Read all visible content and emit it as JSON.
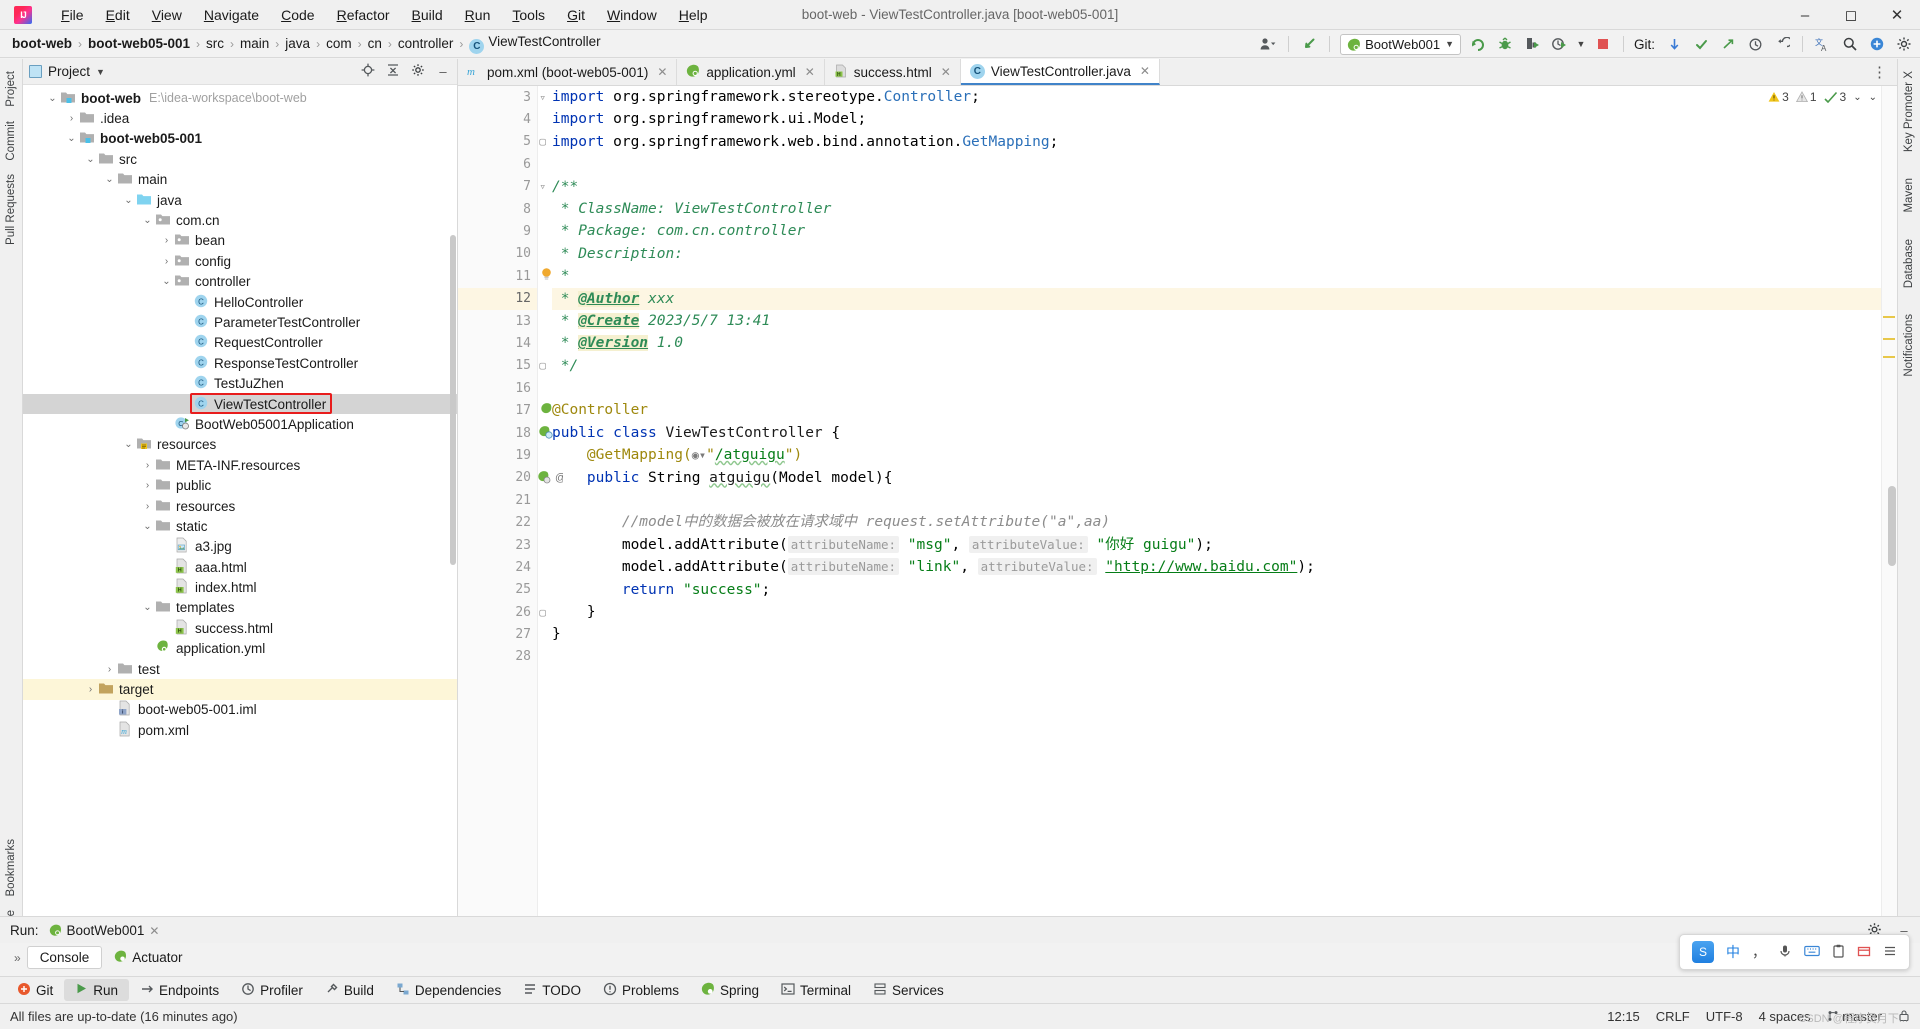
{
  "titlebar": {
    "logo": "intellij-logo",
    "window_title": "boot-web - ViewTestController.java [boot-web05-001]",
    "menus": [
      {
        "label": "File",
        "mnemonic": "F"
      },
      {
        "label": "Edit",
        "mnemonic": "E"
      },
      {
        "label": "View",
        "mnemonic": "V"
      },
      {
        "label": "Navigate",
        "mnemonic": "N"
      },
      {
        "label": "Code",
        "mnemonic": "C"
      },
      {
        "label": "Refactor",
        "mnemonic": "R"
      },
      {
        "label": "Build",
        "mnemonic": "B"
      },
      {
        "label": "Run",
        "mnemonic": "R"
      },
      {
        "label": "Tools",
        "mnemonic": "T"
      },
      {
        "label": "Git",
        "mnemonic": "G"
      },
      {
        "label": "Window",
        "mnemonic": "W"
      },
      {
        "label": "Help",
        "mnemonic": "H"
      }
    ],
    "minimize": "–",
    "maximize": "❐",
    "close": "✕"
  },
  "navbar": {
    "breadcrumbs": [
      {
        "label": "boot-web",
        "bold": true
      },
      {
        "label": "boot-web05-001",
        "bold": true
      },
      {
        "label": "src",
        "bold": false
      },
      {
        "label": "main",
        "bold": false
      },
      {
        "label": "java",
        "bold": false
      },
      {
        "label": "com",
        "bold": false
      },
      {
        "label": "cn",
        "bold": false
      },
      {
        "label": "controller",
        "bold": false
      },
      {
        "label": "ViewTestController",
        "bold": false,
        "icon": "C"
      }
    ],
    "separator": "›",
    "run_config": "BootWeb001",
    "run_config_dropdown": "▼",
    "git_label": "Git:",
    "icons": {
      "account": "account-icon",
      "search_everywhere": "search-icon",
      "run": "run-icon",
      "debug": "debug-icon",
      "coverage": "coverage-icon",
      "profiler": "profiler-icon",
      "stop": "stop-icon",
      "update_project": "update-project-icon",
      "commit": "commit-icon",
      "push": "push-icon",
      "history": "history-icon",
      "rollback": "rollback-icon",
      "translate": "translate-icon",
      "search": "magnifier-icon",
      "plugin": "plugin-icon",
      "settings": "gear-icon"
    }
  },
  "left_strip": {
    "top": [
      "Project",
      "Commit",
      "Pull Requests"
    ],
    "bottom": [
      "Bookmarks",
      "Structure"
    ]
  },
  "right_strip": [
    "Key Promoter X",
    "Maven",
    "Database",
    "Notifications"
  ],
  "project_panel": {
    "title": "Project",
    "dropdown": "▼",
    "locate_icon": "crosshair-icon",
    "collapse_icon": "collapse-all-icon",
    "settings_icon": "gear-icon",
    "hide_icon": "minimize-icon",
    "tree": [
      {
        "indent": 0,
        "arrow": "⌄",
        "icon": "module-folder",
        "label": "boot-web",
        "bold": true,
        "path": "E:\\idea-workspace\\boot-web"
      },
      {
        "indent": 1,
        "arrow": "›",
        "icon": "folder",
        "label": ".idea",
        "bold": false
      },
      {
        "indent": 1,
        "arrow": "⌄",
        "icon": "module-folder",
        "label": "boot-web05-001",
        "bold": true
      },
      {
        "indent": 2,
        "arrow": "⌄",
        "icon": "folder",
        "label": "src",
        "bold": false
      },
      {
        "indent": 3,
        "arrow": "⌄",
        "icon": "folder",
        "label": "main",
        "bold": false
      },
      {
        "indent": 4,
        "arrow": "⌄",
        "icon": "source-folder",
        "label": "java",
        "bold": false
      },
      {
        "indent": 5,
        "arrow": "⌄",
        "icon": "package",
        "label": "com.cn",
        "bold": false
      },
      {
        "indent": 6,
        "arrow": "›",
        "icon": "package",
        "label": "bean",
        "bold": false
      },
      {
        "indent": 6,
        "arrow": "›",
        "icon": "package",
        "label": "config",
        "bold": false
      },
      {
        "indent": 6,
        "arrow": "⌄",
        "icon": "package",
        "label": "controller",
        "bold": false
      },
      {
        "indent": 7,
        "arrow": "",
        "icon": "class",
        "label": "HelloController",
        "bold": false
      },
      {
        "indent": 7,
        "arrow": "",
        "icon": "class",
        "label": "ParameterTestController",
        "bold": false
      },
      {
        "indent": 7,
        "arrow": "",
        "icon": "class",
        "label": "RequestController",
        "bold": false
      },
      {
        "indent": 7,
        "arrow": "",
        "icon": "class",
        "label": "ResponseTestController",
        "bold": false
      },
      {
        "indent": 7,
        "arrow": "",
        "icon": "class",
        "label": "TestJuZhen",
        "bold": false
      },
      {
        "indent": 7,
        "arrow": "",
        "icon": "class",
        "label": "ViewTestController",
        "bold": false,
        "selected": true,
        "annotated": true
      },
      {
        "indent": 6,
        "arrow": "",
        "icon": "spring-class",
        "label": "BootWeb05001Application",
        "bold": false
      },
      {
        "indent": 4,
        "arrow": "⌄",
        "icon": "resource-folder",
        "label": "resources",
        "bold": false
      },
      {
        "indent": 5,
        "arrow": "›",
        "icon": "folder",
        "label": "META-INF.resources",
        "bold": false
      },
      {
        "indent": 5,
        "arrow": "›",
        "icon": "folder",
        "label": "public",
        "bold": false
      },
      {
        "indent": 5,
        "arrow": "›",
        "icon": "folder",
        "label": "resources",
        "bold": false
      },
      {
        "indent": 5,
        "arrow": "⌄",
        "icon": "folder",
        "label": "static",
        "bold": false
      },
      {
        "indent": 6,
        "arrow": "",
        "icon": "image-file",
        "label": "a3.jpg",
        "bold": false
      },
      {
        "indent": 6,
        "arrow": "",
        "icon": "html-file",
        "label": "aaa.html",
        "bold": false
      },
      {
        "indent": 6,
        "arrow": "",
        "icon": "html-file",
        "label": "index.html",
        "bold": false
      },
      {
        "indent": 5,
        "arrow": "⌄",
        "icon": "folder",
        "label": "templates",
        "bold": false
      },
      {
        "indent": 6,
        "arrow": "",
        "icon": "html-file",
        "label": "success.html",
        "bold": false
      },
      {
        "indent": 5,
        "arrow": "",
        "icon": "yml-file",
        "label": "application.yml",
        "bold": false
      },
      {
        "indent": 3,
        "arrow": "›",
        "icon": "folder",
        "label": "test",
        "bold": false
      },
      {
        "indent": 2,
        "arrow": "›",
        "icon": "target-folder",
        "label": "target",
        "bold": false,
        "warn": true
      },
      {
        "indent": 3,
        "arrow": "",
        "icon": "iml-file",
        "label": "boot-web05-001.iml",
        "bold": false
      },
      {
        "indent": 3,
        "arrow": "",
        "icon": "maven-file",
        "label": "pom.xml",
        "bold": false
      }
    ]
  },
  "editor": {
    "tabs": [
      {
        "label": "pom.xml (boot-web05-001)",
        "icon": "maven-icon",
        "active": false,
        "close": "✕"
      },
      {
        "label": "application.yml",
        "icon": "spring-icon",
        "active": false,
        "close": "✕"
      },
      {
        "label": "success.html",
        "icon": "html-icon",
        "active": false,
        "close": "✕"
      },
      {
        "label": "ViewTestController.java",
        "icon": "class-icon",
        "active": true,
        "close": "✕"
      }
    ],
    "more_icon": "⋮",
    "inspections": {
      "warnings": "3",
      "weak_warnings": "1",
      "typos": "3",
      "chevron": "⌄",
      "collapse": "⌄"
    },
    "first_line_number": 3,
    "current_line": 12,
    "lines": [
      {
        "n": 3,
        "gutter": "fold-collapsed"
      },
      {
        "n": 4
      },
      {
        "n": 5,
        "gutter": "fold-end"
      },
      {
        "n": 6
      },
      {
        "n": 7,
        "gutter": "fold-collapsed"
      },
      {
        "n": 8
      },
      {
        "n": 9
      },
      {
        "n": 10
      },
      {
        "n": 11,
        "gutter": "bulb"
      },
      {
        "n": 12,
        "current": true
      },
      {
        "n": 13
      },
      {
        "n": 14
      },
      {
        "n": 15,
        "gutter": "fold-end"
      },
      {
        "n": 16
      },
      {
        "n": 17,
        "gutter": "spring-bean"
      },
      {
        "n": 18,
        "gutter": "spring-class"
      },
      {
        "n": 19
      },
      {
        "n": 20,
        "gutter": "spring-mapping-override"
      },
      {
        "n": 21
      },
      {
        "n": 22
      },
      {
        "n": 23
      },
      {
        "n": 24
      },
      {
        "n": 25
      },
      {
        "n": 26,
        "gutter": "fold-end"
      },
      {
        "n": 27
      },
      {
        "n": 28
      }
    ],
    "code_text": {
      "l3": "import org.springframework.stereotype.Controller;",
      "l4": "import org.springframework.ui.Model;",
      "l5": "import org.springframework.web.bind.annotation.GetMapping;",
      "l7": "/**",
      "l8": " * ClassName: ViewTestController",
      "l9": " * Package: com.cn.controller",
      "l10": " * Description:",
      "l12_tag": "@Author",
      "l12_val": "xxx",
      "l13_tag": "@Create",
      "l13_val": "2023/5/7 13:41",
      "l14_tag": "@Version",
      "l14_val": "1.0",
      "l15": " */",
      "l17": "@Controller",
      "l18": "public class ViewTestController {",
      "l19": "@GetMapping(\"/atguigu\")",
      "l19_path": "/atguigu",
      "l20": "public String atguigu(Model model){",
      "l22": "//model中的数据会被放在请求域中 request.setAttribute(\"a\",aa)",
      "l23_hint1": "attributeName:",
      "l23_str1": "\"msg\"",
      "l23_hint2": "attributeValue:",
      "l23_str2": "\"你好 guigu\"",
      "l24_hint1": "attributeName:",
      "l24_str1": "\"link\"",
      "l24_hint2": "attributeValue:",
      "l24_str2": "\"http://www.baidu.com\"",
      "l25_kw": "return",
      "l25_str": "\"success\"",
      "l26": "}",
      "l27": "}"
    }
  },
  "run_panel": {
    "label": "Run:",
    "config_name": "BootWeb001",
    "close": "✕",
    "settings_icon": "gear-icon",
    "hide_icon": "minimize-icon",
    "expand_icon": "»",
    "tabs": [
      {
        "label": "Console",
        "active": true
      },
      {
        "label": "Actuator",
        "active": false,
        "icon": "actuator-icon"
      }
    ]
  },
  "bottom_bar": {
    "items": [
      {
        "label": "Git",
        "icon": "git-icon",
        "active": false
      },
      {
        "label": "Run",
        "icon": "run-icon",
        "active": true
      },
      {
        "label": "Endpoints",
        "icon": "endpoints-icon",
        "active": false
      },
      {
        "label": "Profiler",
        "icon": "profiler-icon",
        "active": false
      },
      {
        "label": "Build",
        "icon": "build-icon",
        "active": false
      },
      {
        "label": "Dependencies",
        "icon": "dependencies-icon",
        "active": false
      },
      {
        "label": "TODO",
        "icon": "todo-icon",
        "active": false
      },
      {
        "label": "Problems",
        "icon": "problems-icon",
        "active": false
      },
      {
        "label": "Spring",
        "icon": "spring-icon",
        "active": false
      },
      {
        "label": "Terminal",
        "icon": "terminal-icon",
        "active": false
      },
      {
        "label": "Services",
        "icon": "services-icon",
        "active": false
      }
    ]
  },
  "statusbar": {
    "message": "All files are up-to-date (16 minutes ago)",
    "position": "12:15",
    "line_separator": "CRLF",
    "encoding": "UTF-8",
    "indent": "4 spaces",
    "branch": "master",
    "branch_icon": "branch-icon",
    "lock_icon": "lock-icon"
  },
  "ime": {
    "logo": "sogou-ime-logo",
    "lang": "中",
    "comma": "，",
    "mic": "mic-icon",
    "keyboard": "keyboard-icon",
    "clipboard": "clipboard-icon",
    "box": "box-icon",
    "menu": "menu-icon"
  },
  "watermark": "CSDN @程序员月下..."
}
